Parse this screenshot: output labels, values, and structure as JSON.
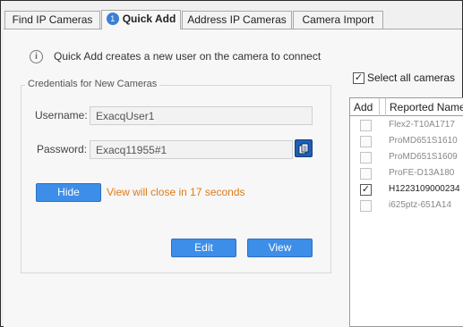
{
  "tabs": [
    {
      "label": "Find IP Cameras"
    },
    {
      "label": "Quick Add",
      "badge": "1",
      "active": true
    },
    {
      "label": "Address IP Cameras"
    },
    {
      "label": "Camera Import"
    }
  ],
  "info": {
    "text": "Quick Add creates a new user on the camera to connect"
  },
  "credentials": {
    "title": "Credentials for New Cameras",
    "username_label": "Username:",
    "username_value": "ExacqUser1",
    "password_label": "Password:",
    "password_value": "Exacq11955#1"
  },
  "actions": {
    "hide_label": "Hide",
    "countdown_text": "View will close in 17 seconds",
    "edit_label": "Edit",
    "view_label": "View"
  },
  "camera_list": {
    "select_all_label": "Select all cameras",
    "select_all_checked": true,
    "columns": [
      "Add",
      "Reported Name"
    ],
    "rows": [
      {
        "name": "Flex2-T10A1717",
        "checked": false
      },
      {
        "name": "ProMD651S1610",
        "checked": false
      },
      {
        "name": "ProMD651S1609",
        "checked": false
      },
      {
        "name": "ProFE-D13A180",
        "checked": false
      },
      {
        "name": "H1223109000234",
        "checked": true
      },
      {
        "name": "i625ptz-651A14",
        "checked": false
      }
    ]
  },
  "colors": {
    "accent": "#3d8ee8",
    "countdown": "#e07b1a",
    "badge": "#3a7fd5"
  }
}
